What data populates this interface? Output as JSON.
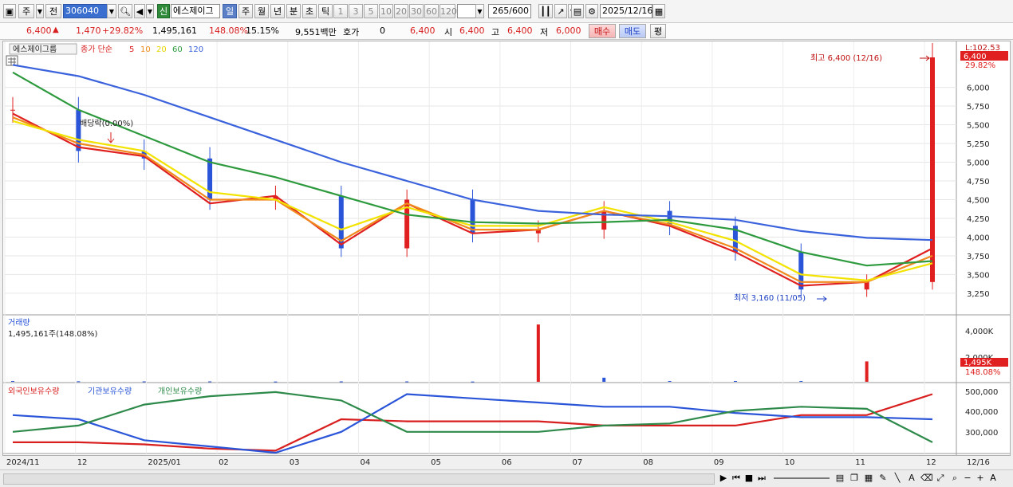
{
  "toolbar": {
    "market": "주",
    "prev": "전",
    "code": "306040",
    "new_badge": "신",
    "stock_name": "에스제이그",
    "periods": [
      "일",
      "주",
      "월",
      "년",
      "분",
      "초",
      "틱"
    ],
    "intervals": [
      "1",
      "3",
      "5",
      "10",
      "20",
      "30",
      "60",
      "120"
    ],
    "count": "265",
    "count_max": "/600",
    "date": "2025/12/16"
  },
  "quote": {
    "price": "6,400",
    "change": "1,470",
    "change_pct": "+29.82%",
    "volume": "1,495,161",
    "volume_ratio": "148.08%",
    "turnover": "15.15%",
    "amount": "9,551백만",
    "hoga_label": "호가",
    "hoga_value": "0",
    "hoga_price": "6,400",
    "open_label": "시",
    "open": "6,400",
    "high_label": "고",
    "high": "6,400",
    "low_label": "저",
    "low": "6,000",
    "buy": "매수",
    "sell": "매도",
    "eval": "평"
  },
  "price_panel": {
    "name": "에스제이그룹",
    "ma_title": "종가 단순",
    "ma_periods": [
      "5",
      "10",
      "20",
      "60",
      "120"
    ],
    "ma_colors": [
      "#e02020",
      "#f08a1c",
      "#f2e300",
      "#2e9a3e",
      "#3a62dc"
    ],
    "top_right_label": "L:102.53",
    "last_price": "6,400",
    "last_pct": "29.82%",
    "high_note": "최고 6,400 (12/16)",
    "low_note": "최저 3,160 (11/05)",
    "dividend_note": "배당락(0.00%)",
    "y_ticks": [
      "6,000",
      "5,750",
      "5,500",
      "5,250",
      "5,000",
      "4,750",
      "4,500",
      "4,250",
      "4,000",
      "3,750",
      "3,500",
      "3,250"
    ]
  },
  "volume_panel": {
    "title": "거래량",
    "value": "1,495,161주(148.08%)",
    "y_ticks": [
      "4,000K",
      "2,000K"
    ],
    "last_value": "1,495K",
    "last_pct": "148.08%"
  },
  "holder_panel": {
    "legend": [
      "외국인보유수량",
      "기관보유수량",
      "개인보유수량"
    ],
    "legend_colors": [
      "#d81e1e",
      "#2a55d8",
      "#2e8a4a"
    ],
    "y_ticks": [
      "500,000",
      "400,000",
      "300,000"
    ]
  },
  "x_axis": [
    "2024/11",
    "12",
    "2025/01",
    "02",
    "03",
    "04",
    "05",
    "06",
    "07",
    "08",
    "09",
    "10",
    "11",
    "12"
  ],
  "x_axis_right": "12/16",
  "chart_data": [
    {
      "type": "candlestick",
      "title": "에스제이그룹",
      "ylim": [
        3100,
        6400
      ],
      "x": [
        "2024/11",
        "12",
        "2025/01",
        "02",
        "03",
        "04",
        "05",
        "06",
        "07",
        "08",
        "09",
        "10",
        "11",
        "12",
        "12/16"
      ],
      "series": [
        {
          "name": "종가",
          "values": [
            5700,
            5150,
            5050,
            4500,
            4550,
            3850,
            4500,
            4050,
            4100,
            4350,
            4150,
            3800,
            3300,
            3400,
            6400
          ]
        },
        {
          "name": "5",
          "values": [
            5650,
            5200,
            5080,
            4450,
            4550,
            3900,
            4450,
            4050,
            4100,
            4350,
            4150,
            3800,
            3350,
            3400,
            3850
          ]
        },
        {
          "name": "10",
          "values": [
            5600,
            5250,
            5100,
            4500,
            4500,
            3950,
            4450,
            4100,
            4100,
            4350,
            4170,
            3850,
            3400,
            3400,
            3750
          ]
        },
        {
          "name": "20",
          "values": [
            5550,
            5300,
            5150,
            4600,
            4500,
            4100,
            4400,
            4150,
            4150,
            4400,
            4200,
            3950,
            3500,
            3420,
            3650
          ]
        },
        {
          "name": "60",
          "values": [
            6200,
            5700,
            5350,
            5000,
            4800,
            4550,
            4300,
            4200,
            4180,
            4200,
            4230,
            4100,
            3800,
            3620,
            3680
          ]
        },
        {
          "name": "120",
          "values": [
            6300,
            6150,
            5900,
            5600,
            5300,
            5000,
            4750,
            4500,
            4350,
            4300,
            4280,
            4230,
            4080,
            3990,
            3960
          ]
        }
      ],
      "high": {
        "value": 6400,
        "date": "12/16"
      },
      "low": {
        "value": 3160,
        "date": "11/05"
      }
    },
    {
      "type": "bar",
      "title": "거래량",
      "ylim": [
        0,
        4500
      ],
      "values_k": [
        60,
        40,
        30,
        30,
        20,
        30,
        30,
        20,
        4200,
        300,
        60,
        60,
        60,
        1495
      ]
    },
    {
      "type": "line",
      "title": "보유수량",
      "ylim": [
        200000,
        520000
      ],
      "series": [
        {
          "name": "외국인보유수량",
          "values": [
            250000,
            250000,
            240000,
            220000,
            210000,
            360000,
            350000,
            350000,
            350000,
            330000,
            330000,
            330000,
            380000,
            380000,
            480000
          ]
        },
        {
          "name": "기관보유수량",
          "values": [
            380000,
            360000,
            260000,
            230000,
            200000,
            300000,
            480000,
            460000,
            440000,
            420000,
            420000,
            390000,
            370000,
            370000,
            360000
          ]
        },
        {
          "name": "개인보유수량",
          "values": [
            300000,
            330000,
            430000,
            470000,
            490000,
            450000,
            300000,
            300000,
            300000,
            330000,
            340000,
            400000,
            420000,
            410000,
            250000
          ]
        }
      ]
    }
  ]
}
